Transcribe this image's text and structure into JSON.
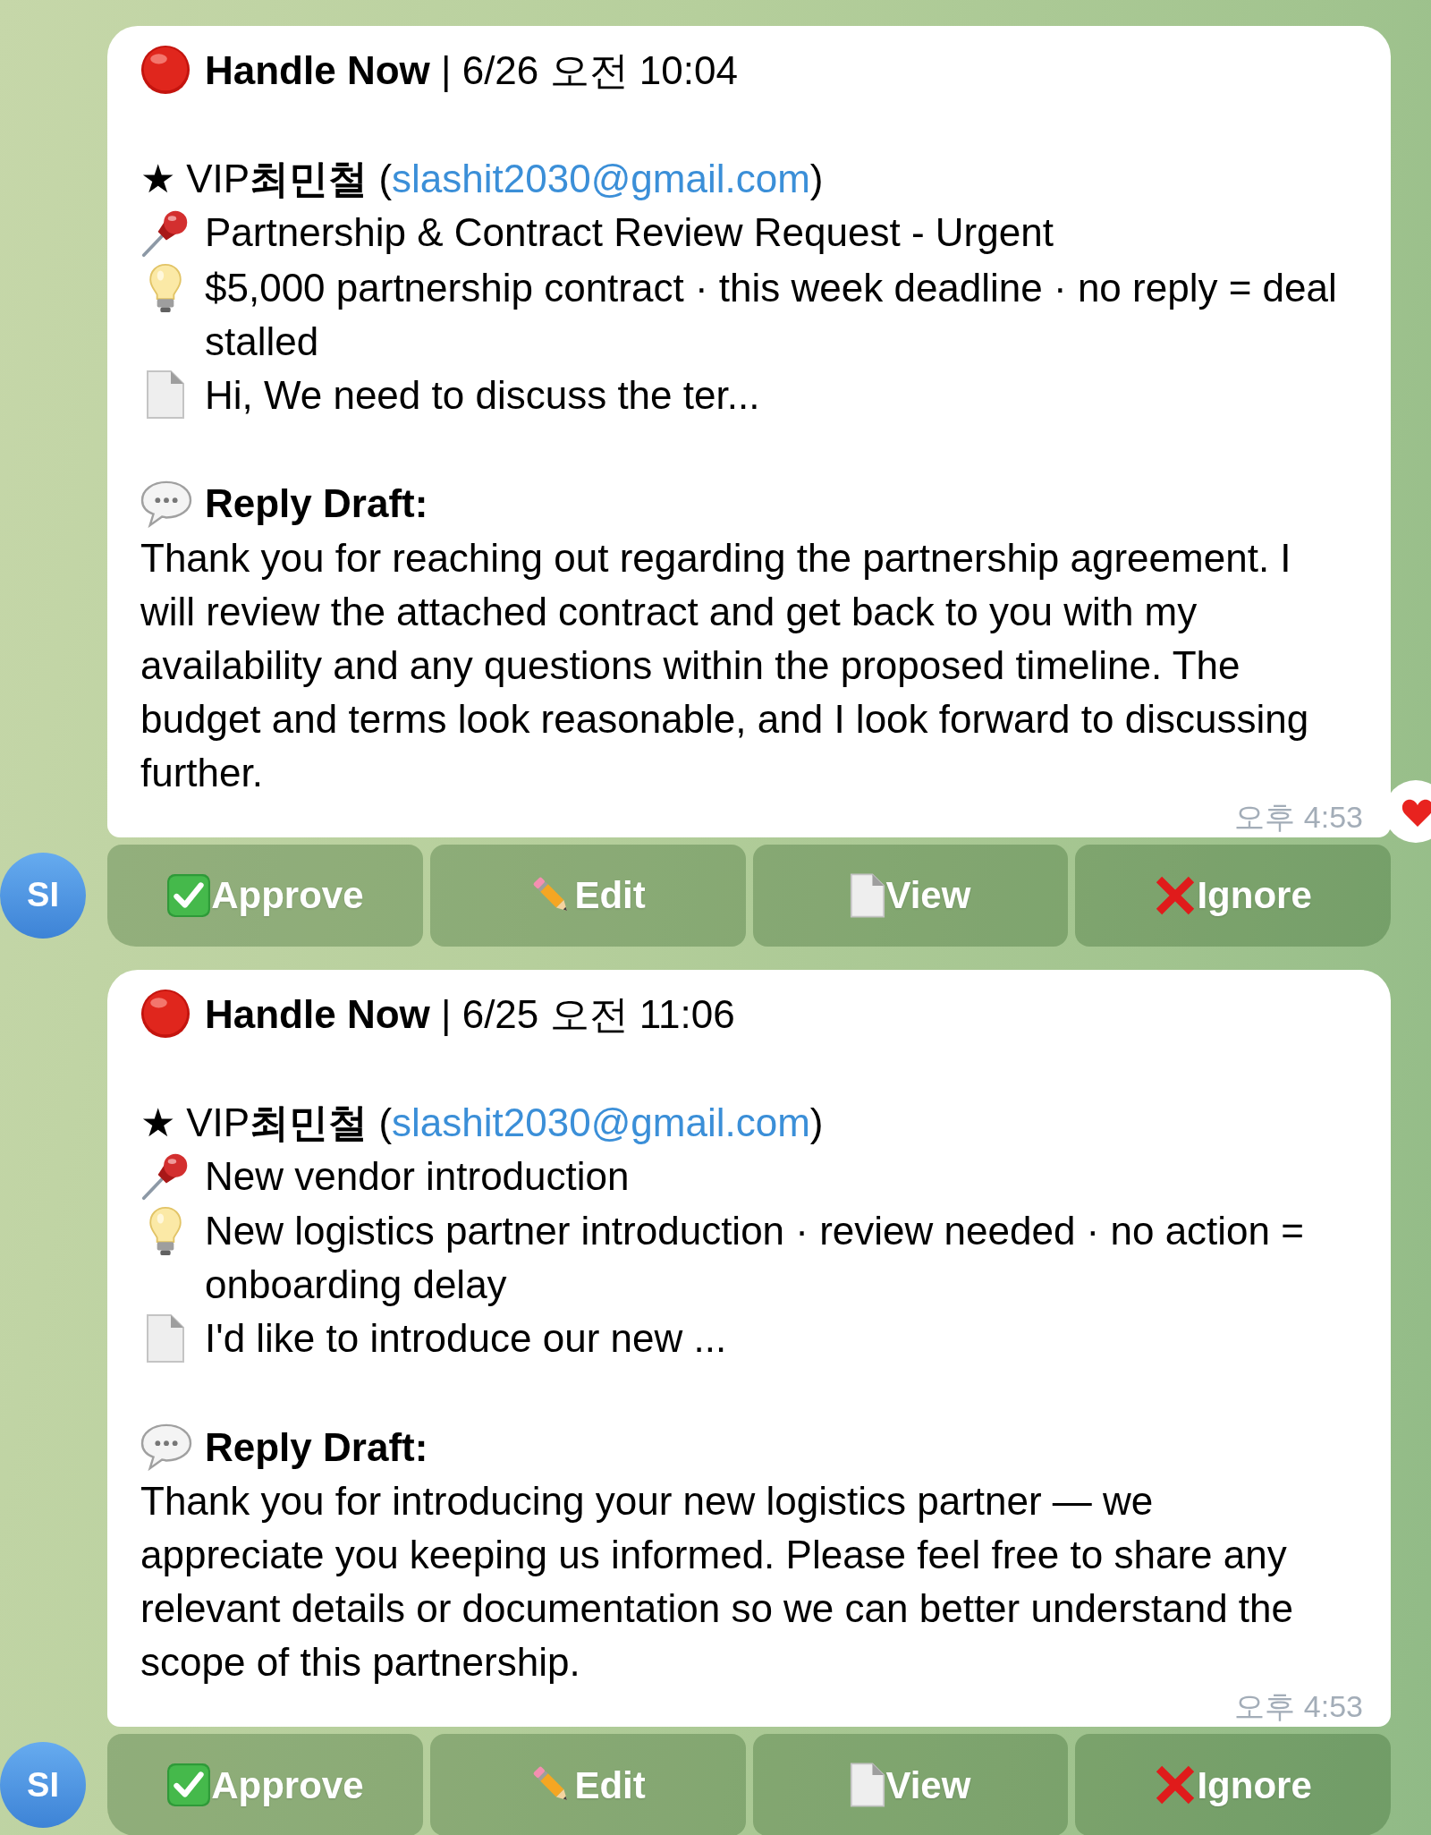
{
  "messages": [
    {
      "header": "**Handle Now** | 6/26 오전 10:04",
      "sender": {
        "text_before_link": "★ VIP**최민철** (",
        "link": "slashit2030@gmail.com",
        "text_after_link": ")"
      },
      "subject": "Partnership & Contract Review Request - Urgent",
      "summary": "$5,000 partnership contract · this week deadline · no reply = deal stalled",
      "preview": "Hi, We need to discuss the ter...",
      "reply_label": "Reply Draft:",
      "reply_draft": "Thank you for reaching out regarding the partnership agreement. I will review the attached contract and get back to you with my availability and any questions within the proposed timeline. The budget and terms look reasonable, and I look forward to discussing further.",
      "time": "오후 4:53",
      "reacted": true,
      "avatar": "SI",
      "buttons": [
        {
          "kind": "approve",
          "label": "Approve"
        },
        {
          "kind": "edit",
          "label": "Edit"
        },
        {
          "kind": "view",
          "label": "View"
        },
        {
          "kind": "ignore",
          "label": "Ignore"
        }
      ]
    },
    {
      "header": "**Handle Now** | 6/25 오전 11:06",
      "sender": {
        "text_before_link": "★ VIP**최민철** (",
        "link": "slashit2030@gmail.com",
        "text_after_link": ")"
      },
      "subject": "New vendor introduction",
      "summary": "New logistics partner introduction · review needed · no action = onboarding delay",
      "preview": "I'd like to introduce our new ...",
      "reply_label": "Reply Draft:",
      "reply_draft": "Thank you for introducing your new logistics partner — we appreciate you keeping us informed. Please feel free to share any relevant details or documentation so we can better understand the scope of this partnership.",
      "time": "오후 4:53",
      "reacted": false,
      "avatar": "SI",
      "buttons": [
        {
          "kind": "approve",
          "label": "Approve"
        },
        {
          "kind": "edit",
          "label": "Edit"
        },
        {
          "kind": "view",
          "label": "View"
        },
        {
          "kind": "ignore",
          "label": "Ignore"
        }
      ]
    }
  ]
}
